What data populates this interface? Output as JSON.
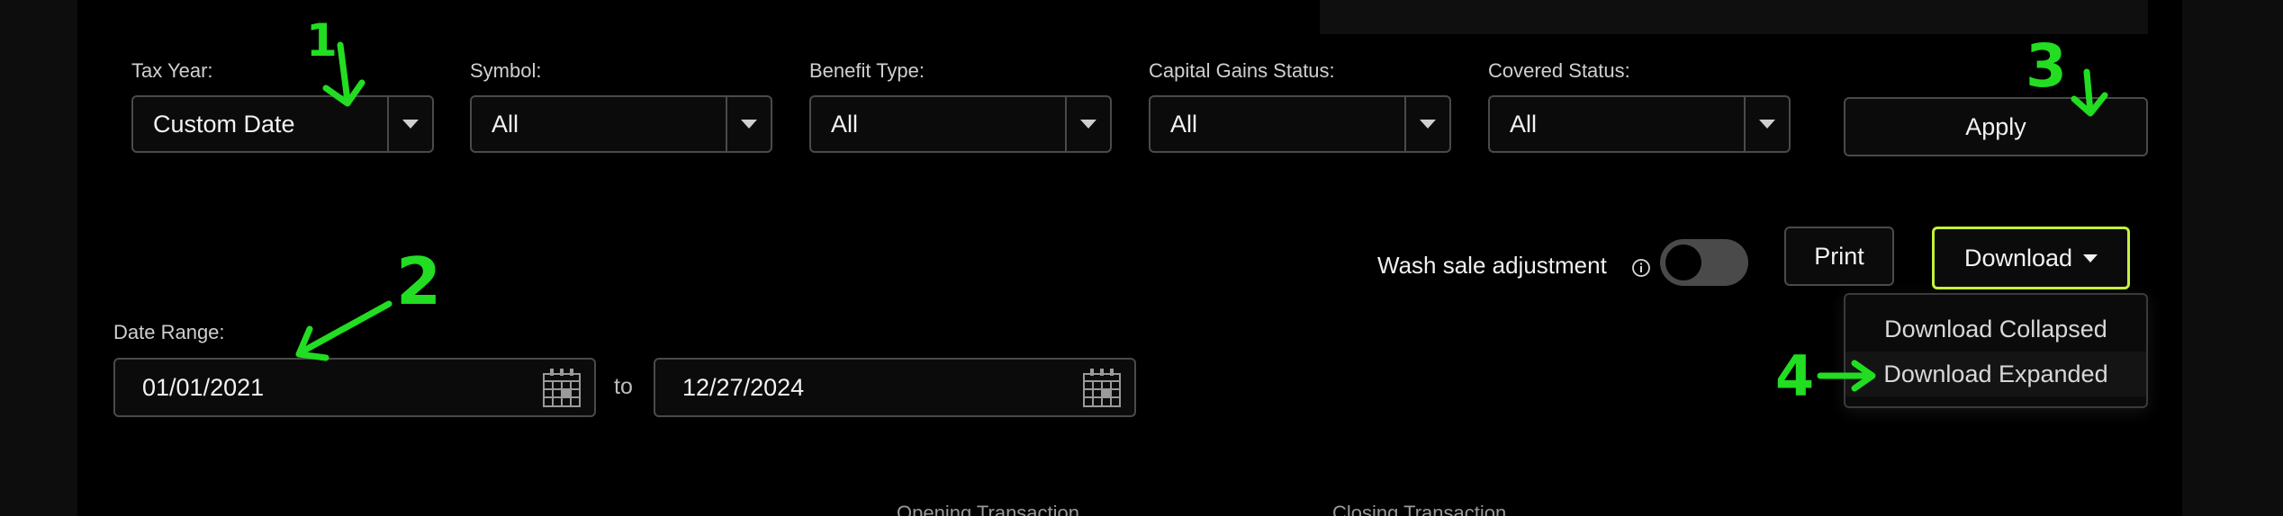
{
  "filters": [
    {
      "label": "Tax Year:",
      "value": "Custom Date"
    },
    {
      "label": "Symbol:",
      "value": "All"
    },
    {
      "label": "Benefit Type:",
      "value": "All"
    },
    {
      "label": "Capital Gains Status:",
      "value": "All"
    },
    {
      "label": "Covered Status:",
      "value": "All"
    }
  ],
  "apply_label": "Apply",
  "wash_sale": {
    "label": "Wash sale adjustment",
    "enabled": false
  },
  "print_label": "Print",
  "download": {
    "label": "Download",
    "menu": [
      "Download Collapsed",
      "Download Expanded"
    ]
  },
  "date_range": {
    "label": "Date Range:",
    "from": "01/01/2021",
    "separator": "to",
    "to": "12/27/2024"
  },
  "table_headers_partial": [
    "Opening Transaction",
    "Closing Transaction"
  ],
  "annotations": [
    "1",
    "2",
    "3",
    "4"
  ],
  "colors": {
    "annotation": "#22dd22",
    "download_border": "#c4f23a"
  },
  "icons": [
    "dropdown-caret-icon",
    "calendar-icon",
    "info-icon",
    "caret-down-icon",
    "arrow-icon"
  ]
}
